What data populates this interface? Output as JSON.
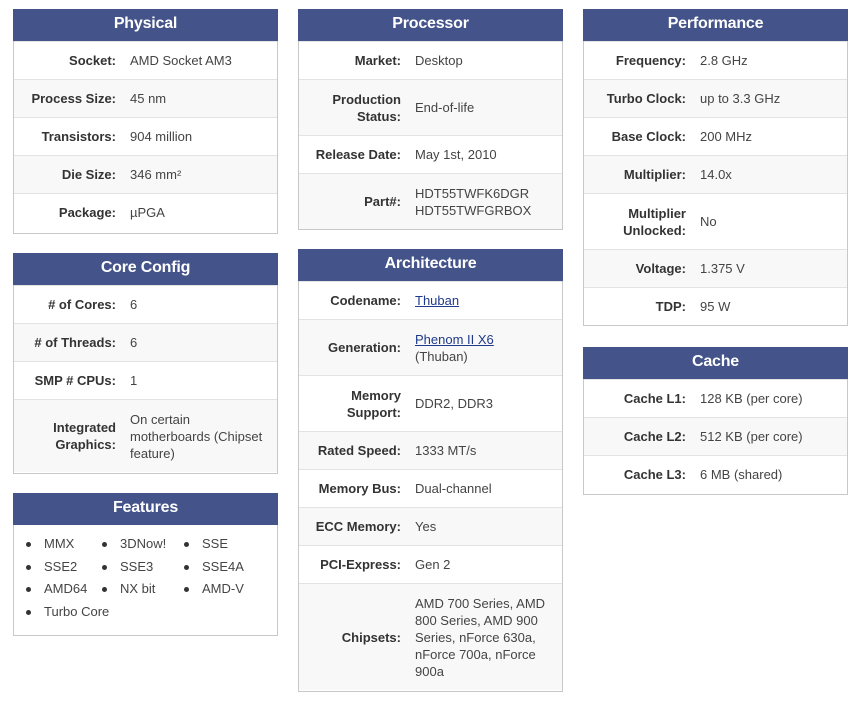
{
  "physical": {
    "title": "Physical",
    "rows": [
      {
        "label": "Socket:",
        "value": "AMD Socket AM3"
      },
      {
        "label": "Process Size:",
        "value": "45 nm"
      },
      {
        "label": "Transistors:",
        "value": "904 million"
      },
      {
        "label": "Die Size:",
        "value": "346 mm²"
      },
      {
        "label": "Package:",
        "value": "µPGA"
      }
    ]
  },
  "core_config": {
    "title": "Core Config",
    "rows": [
      {
        "label": "# of Cores:",
        "value": "6"
      },
      {
        "label": "# of Threads:",
        "value": "6"
      },
      {
        "label": "SMP # CPUs:",
        "value": "1"
      },
      {
        "label": "Integrated Graphics:",
        "value": "On certain motherboards (Chipset feature)"
      }
    ]
  },
  "features": {
    "title": "Features",
    "items": [
      "MMX",
      "3DNow!",
      "SSE",
      "SSE2",
      "SSE3",
      "SSE4A",
      "AMD64",
      "NX bit",
      "AMD-V",
      "Turbo Core"
    ]
  },
  "processor": {
    "title": "Processor",
    "rows": [
      {
        "label": "Market:",
        "value": "Desktop"
      },
      {
        "label": "Production Status:",
        "value": "End-of-life"
      },
      {
        "label": "Release Date:",
        "value": "May 1st, 2010"
      },
      {
        "label": "Part#:",
        "value_line1": "HDT55TWFK6DGR",
        "value_line2": "HDT55TWFGRBOX"
      }
    ]
  },
  "architecture": {
    "title": "Architecture",
    "rows": [
      {
        "label": "Codename:",
        "link": "Thuban"
      },
      {
        "label": "Generation:",
        "link": "Phenom II X6",
        "extra": "(Thuban)"
      },
      {
        "label": "Memory Support:",
        "value": "DDR2, DDR3"
      },
      {
        "label": "Rated Speed:",
        "value": "1333 MT/s"
      },
      {
        "label": "Memory Bus:",
        "value": "Dual-channel"
      },
      {
        "label": "ECC Memory:",
        "value": "Yes"
      },
      {
        "label": "PCI-Express:",
        "value": "Gen 2"
      },
      {
        "label": "Chipsets:",
        "value": "AMD 700 Series, AMD 800 Series, AMD 900 Series, nForce 630a, nForce 700a, nForce 900a"
      }
    ]
  },
  "performance": {
    "title": "Performance",
    "rows": [
      {
        "label": "Frequency:",
        "value": "2.8 GHz"
      },
      {
        "label": "Turbo Clock:",
        "value": "up to 3.3 GHz"
      },
      {
        "label": "Base Clock:",
        "value": "200 MHz"
      },
      {
        "label": "Multiplier:",
        "value": "14.0x"
      },
      {
        "label": "Multiplier Unlocked:",
        "value": "No"
      },
      {
        "label": "Voltage:",
        "value": "1.375 V"
      },
      {
        "label": "TDP:",
        "value": "95 W"
      }
    ]
  },
  "cache": {
    "title": "Cache",
    "rows": [
      {
        "label": "Cache L1:",
        "value": "128 KB (per core)"
      },
      {
        "label": "Cache L2:",
        "value": "512 KB (per core)"
      },
      {
        "label": "Cache L3:",
        "value": "6 MB (shared)"
      }
    ]
  }
}
